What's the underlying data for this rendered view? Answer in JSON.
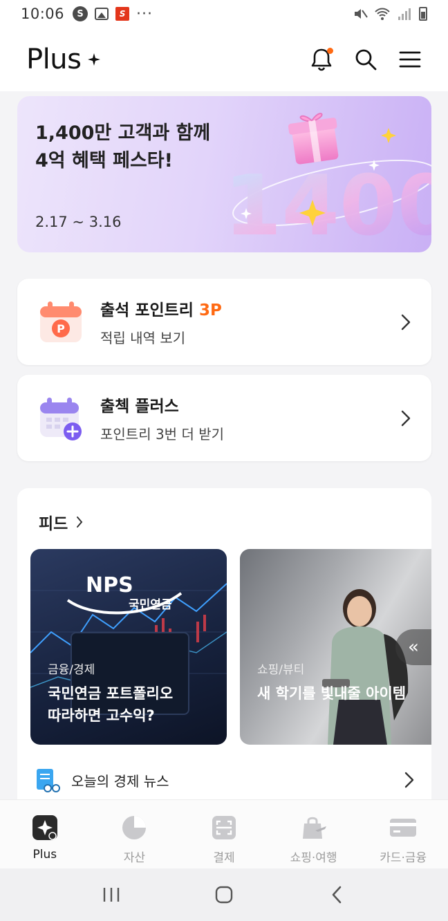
{
  "statusbar": {
    "time": "10:06",
    "s_badge": "S",
    "red_badge": "S",
    "more": "···"
  },
  "header": {
    "brand": "Plus"
  },
  "banner": {
    "line1": "1,400만 고객과 함께",
    "line2": "4억 혜택 페스타!",
    "date": "2.17 ~ 3.16",
    "art_text": "1400"
  },
  "cards": [
    {
      "title": "출석 포인트리 ",
      "points": "3P",
      "sub": "적립 내역 보기",
      "icon_letter": "P"
    },
    {
      "title": "출첵 플러스",
      "sub": "포인트리 3번 더 받기"
    }
  ],
  "feed": {
    "title": "피드",
    "items": [
      {
        "category": "금융/경제",
        "title_line1": "국민연금 포트폴리오",
        "title_line2": "따라하면 고수익?",
        "logo_top": "NPS",
        "logo_bottom": "국민연금"
      },
      {
        "category": "쇼핑/뷰티",
        "title_line1": "새 학기를 빛내줄 아이템"
      }
    ],
    "prev_label": "«",
    "news_label": "오늘의 경제 뉴스"
  },
  "bottomnav": {
    "items": [
      {
        "label": "Plus",
        "icon": "plus-sparkle-icon",
        "active": true
      },
      {
        "label": "자산",
        "icon": "pie-chart-icon"
      },
      {
        "label": "결제",
        "icon": "scan-icon"
      },
      {
        "label": "쇼핑·여행",
        "icon": "shopping-bag-icon"
      },
      {
        "label": "카드·금융",
        "icon": "card-icon"
      }
    ]
  },
  "colors": {
    "accent_orange": "#ff6a13",
    "banner_purple": "#c9b0f5"
  }
}
